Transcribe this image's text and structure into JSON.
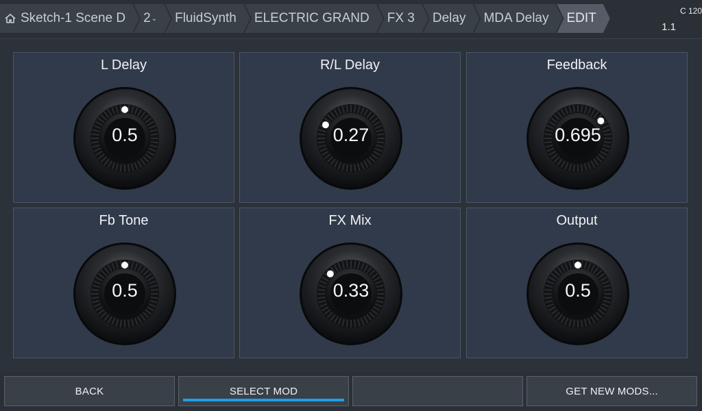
{
  "breadcrumbs": [
    {
      "label": "Sketch-1 Scene D",
      "icon": "home-icon"
    },
    {
      "label": "2",
      "sub": "⌄"
    },
    {
      "label": "FluidSynth"
    },
    {
      "label": "ELECTRIC GRAND"
    },
    {
      "label": "FX 3"
    },
    {
      "label": "Delay"
    },
    {
      "label": "MDA Delay"
    },
    {
      "label": "EDIT",
      "active": true
    }
  ],
  "status": {
    "tempo": "C 120",
    "position": "1.1"
  },
  "params": [
    {
      "label": "L Delay",
      "value": "0.5",
      "level": 0.5
    },
    {
      "label": "R/L Delay",
      "value": "0.27",
      "level": 0.27
    },
    {
      "label": "Feedback",
      "value": "0.695",
      "level": 0.695
    },
    {
      "label": "Fb Tone",
      "value": "0.5",
      "level": 0.5
    },
    {
      "label": "FX Mix",
      "value": "0.33",
      "level": 0.33
    },
    {
      "label": "Output",
      "value": "0.5",
      "level": 0.5
    }
  ],
  "buttons": {
    "back": "BACK",
    "select_mod": "SELECT MOD",
    "empty": "",
    "get_new_mods": "GET NEW MODS..."
  },
  "colors": {
    "accent": "#1e9fe6",
    "panel": "#313a4a",
    "background": "#2c323a"
  }
}
